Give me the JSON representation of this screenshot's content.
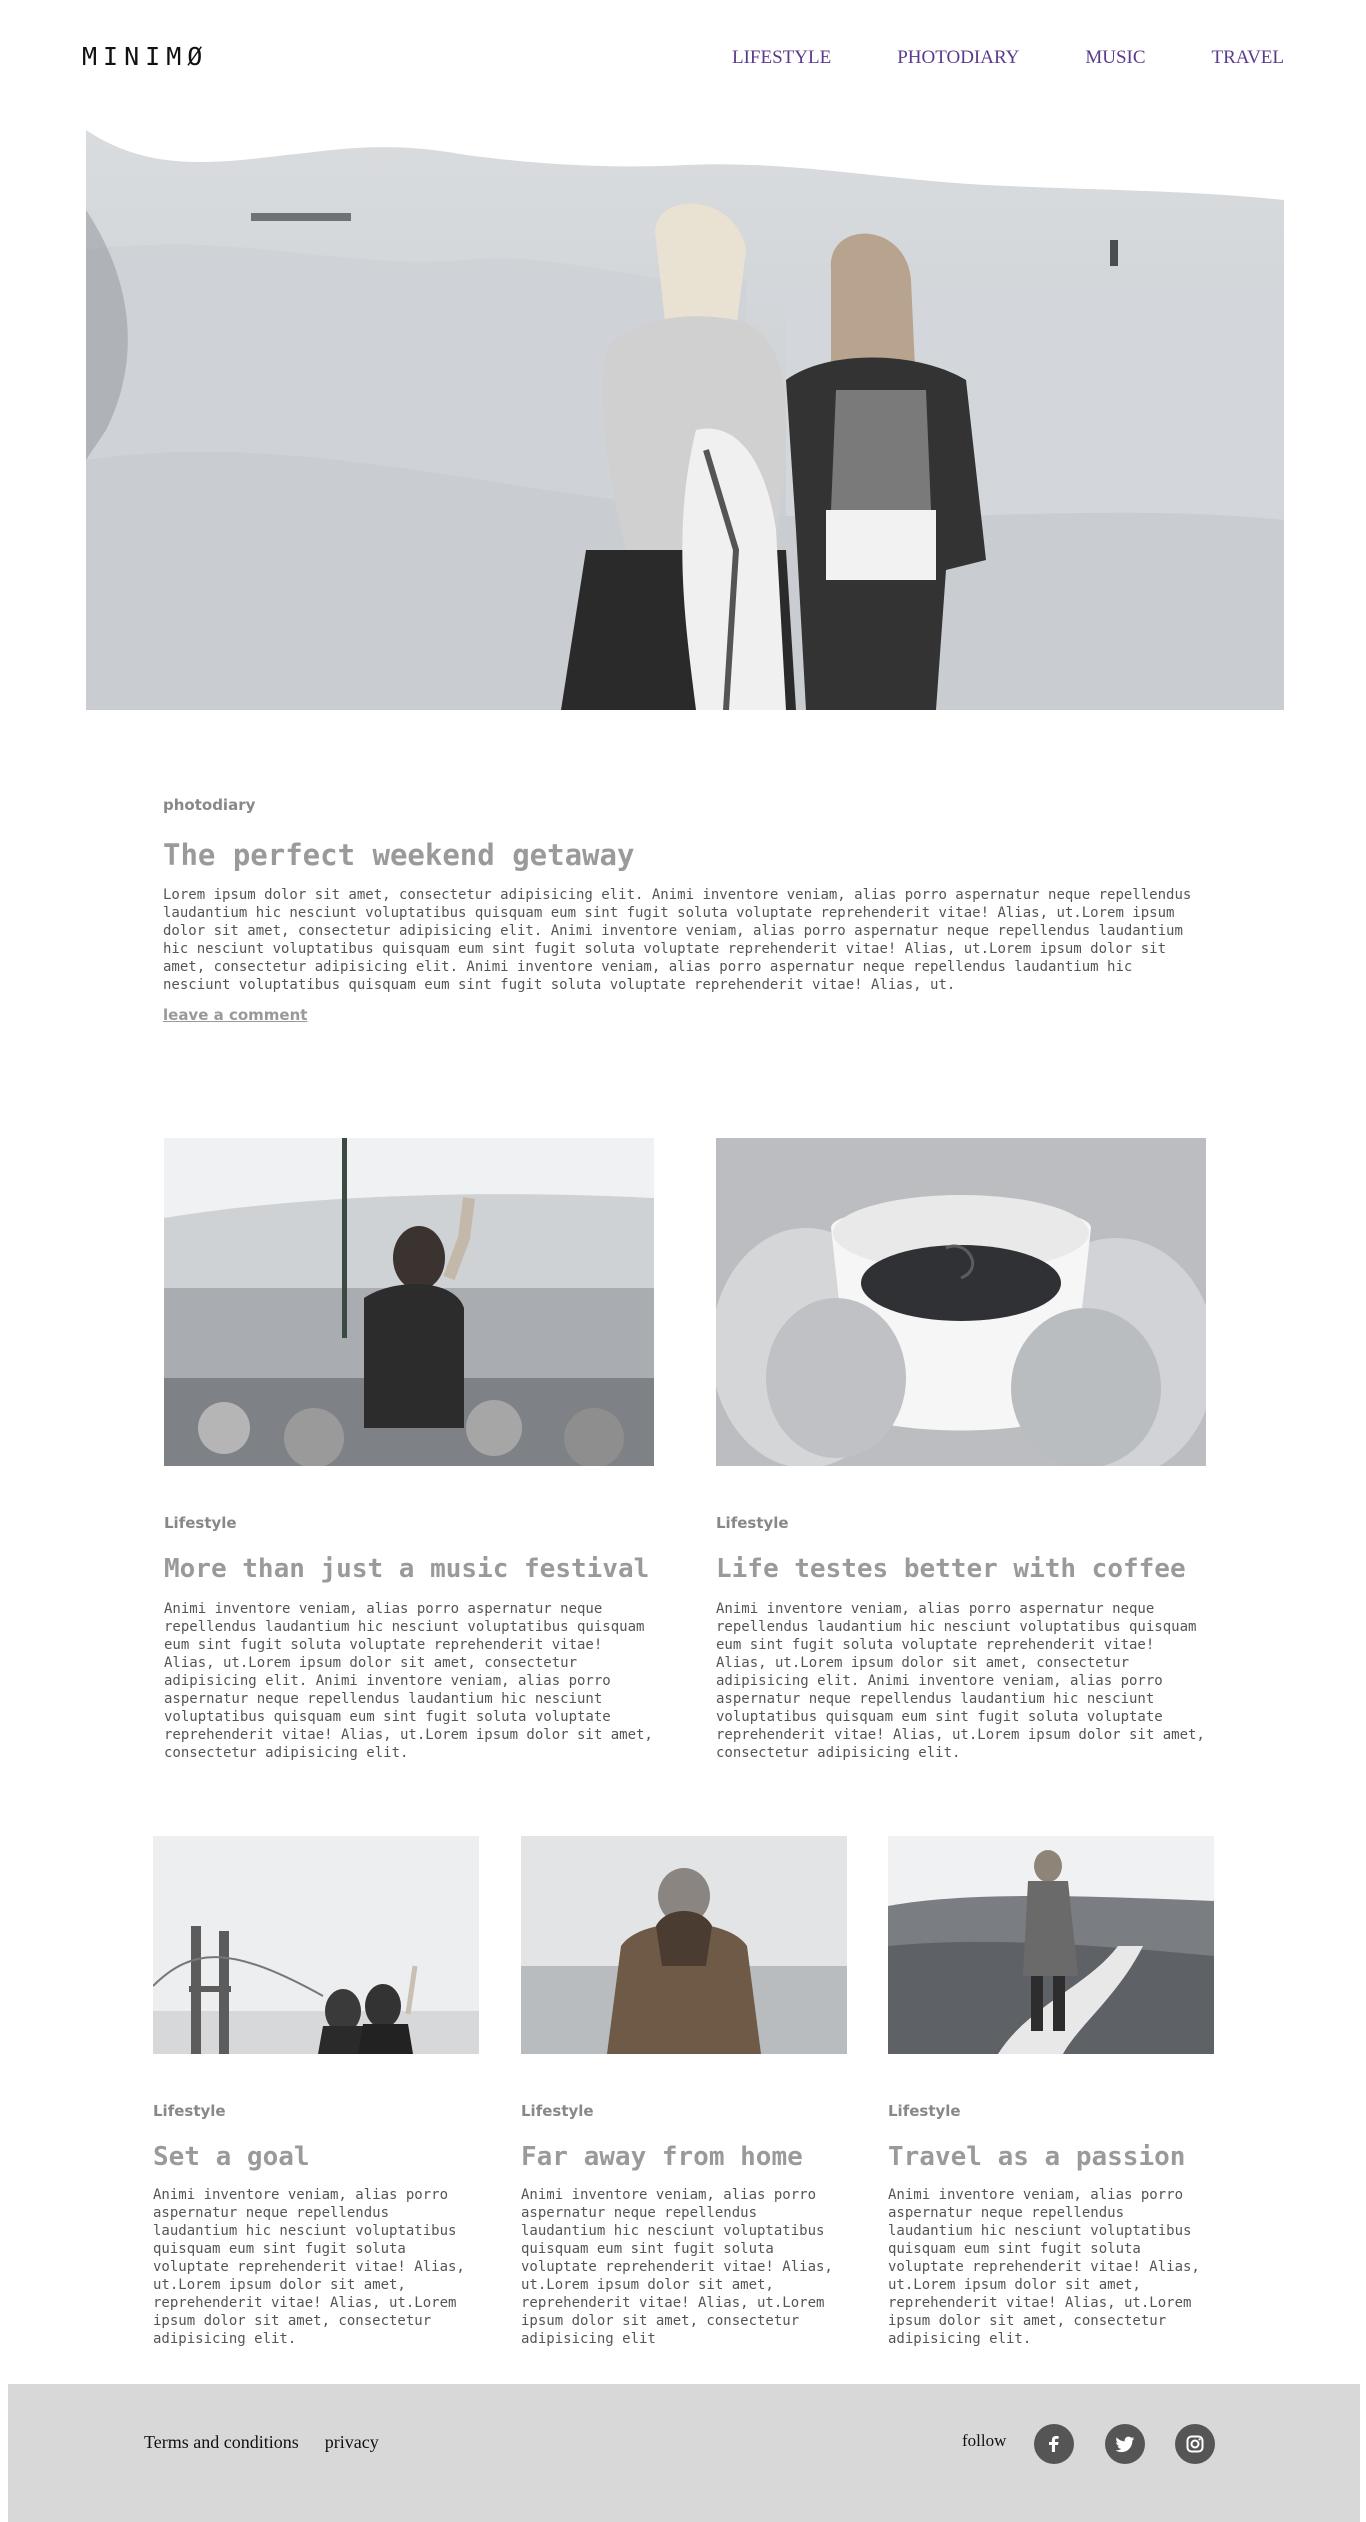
{
  "header": {
    "logo": "MINIMØ",
    "nav": [
      "LIFESTYLE",
      "PHOTODIARY",
      "MUSIC",
      "TRAVEL"
    ]
  },
  "hero": {
    "image": "two-women-on-snowy-dunes-photo"
  },
  "featured": {
    "category": "photodiary",
    "title": "The perfect weekend getaway",
    "body": "Lorem ipsum dolor sit amet, consectetur adipisicing elit. Animi inventore veniam, alias porro aspernatur neque repellendus laudantium hic nesciunt voluptatibus quisquam eum sint fugit soluta voluptate reprehenderit vitae! Alias, ut.Lorem ipsum dolor sit amet, consectetur adipisicing elit. Animi inventore veniam, alias porro aspernatur neque repellendus laudantium hic nesciunt voluptatibus quisquam eum sint fugit soluta voluptate reprehenderit vitae! Alias, ut.Lorem ipsum dolor sit amet, consectetur adipisicing elit. Animi inventore veniam, alias porro aspernatur neque repellendus laudantium hic nesciunt voluptatibus quisquam eum sint fugit soluta voluptate reprehenderit vitae! Alias, ut.",
    "comment_link": "leave a comment"
  },
  "posts_two": [
    {
      "category": "Lifestyle",
      "title": "More than just a music festival",
      "body": "Animi inventore veniam, alias porro aspernatur neque repellendus laudantium hic nesciunt voluptatibus quisquam eum sint fugit soluta voluptate reprehenderit vitae! Alias, ut.Lorem ipsum dolor sit amet, consectetur adipisicing elit. Animi inventore veniam, alias porro aspernatur neque repellendus laudantium hic nesciunt voluptatibus quisquam eum sint fugit soluta voluptate reprehenderit vitae! Alias, ut.Lorem ipsum dolor sit amet, consectetur adipisicing elit."
    },
    {
      "category": "Lifestyle",
      "title": "Life testes better with coffee",
      "body": "Animi inventore veniam, alias porro aspernatur neque repellendus laudantium hic nesciunt voluptatibus quisquam eum sint fugit soluta voluptate reprehenderit vitae! Alias, ut.Lorem ipsum dolor sit amet, consectetur adipisicing elit. Animi inventore veniam, alias porro aspernatur neque repellendus laudantium hic nesciunt voluptatibus quisquam eum sint fugit soluta voluptate reprehenderit vitae! Alias, ut.Lorem ipsum dolor sit amet, consectetur adipisicing elit."
    }
  ],
  "posts_three": [
    {
      "category": "Lifestyle",
      "title": "Set a goal",
      "body": "Animi inventore veniam, alias porro aspernatur neque repellendus laudantium hic nesciunt voluptatibus quisquam eum sint fugit soluta voluptate reprehenderit vitae! Alias, ut.Lorem ipsum dolor sit amet, reprehenderit vitae! Alias, ut.Lorem ipsum dolor sit amet, consectetur adipisicing elit."
    },
    {
      "category": "Lifestyle",
      "title": "Far away from home",
      "body": "Animi inventore veniam, alias porro aspernatur neque repellendus laudantium hic nesciunt voluptatibus quisquam eum sint fugit soluta voluptate reprehenderit vitae! Alias, ut.Lorem ipsum dolor sit amet, reprehenderit vitae! Alias, ut.Lorem ipsum dolor sit amet, consectetur adipisicing elit"
    },
    {
      "category": "Lifestyle",
      "title": "Travel as a passion",
      "body": "Animi inventore veniam, alias porro aspernatur neque repellendus laudantium hic nesciunt voluptatibus quisquam eum sint fugit soluta voluptate reprehenderit vitae! Alias, ut.Lorem ipsum dolor sit amet, reprehenderit vitae! Alias, ut.Lorem ipsum dolor sit amet, consectetur adipisicing elit."
    }
  ],
  "footer": {
    "links": [
      "Terms and conditions",
      "privacy"
    ],
    "follow_label": "follow",
    "social": [
      "facebook-icon",
      "twitter-icon",
      "instagram-icon"
    ]
  },
  "colors": {
    "nav": "#5b3a8c",
    "title": "#9a9a9a",
    "footer_bg": "#d8d8d8",
    "social_bg": "#555555"
  }
}
